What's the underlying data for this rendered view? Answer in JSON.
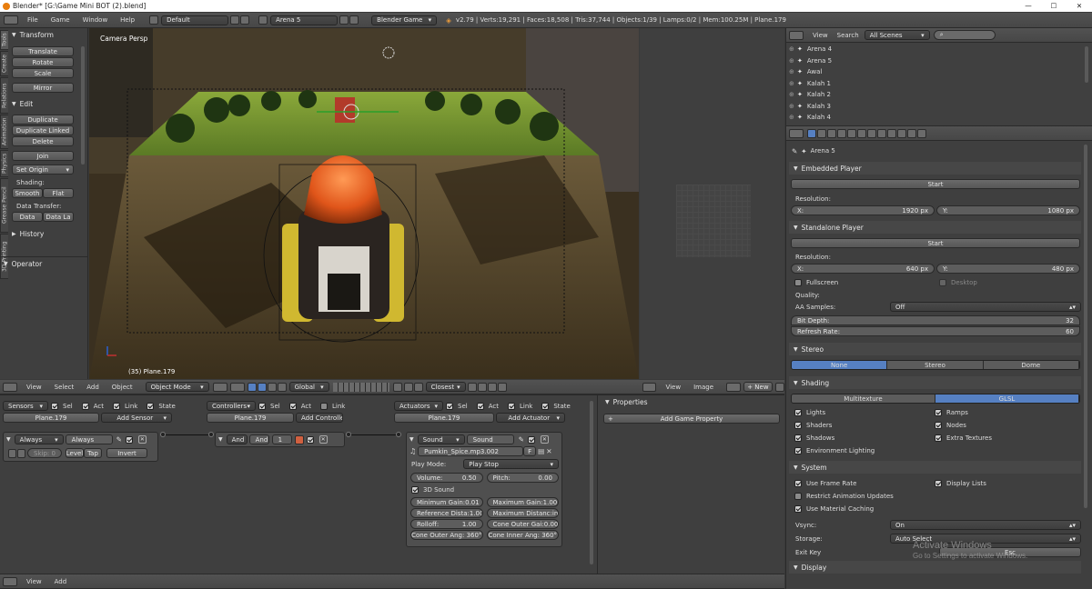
{
  "window": {
    "title": "Blender* [G:\\Game Mini BOT (2).blend]",
    "controls": {
      "min": "—",
      "max": "☐",
      "close": "✕"
    }
  },
  "topbar": {
    "menus": [
      "File",
      "Game",
      "Window",
      "Help"
    ],
    "layout": "Default",
    "scene": "Arena 5",
    "engine": "Blender Game",
    "stats": "v2.79 | Verts:19,291 | Faces:18,508 | Tris:37,744 | Objects:1/39 | Lamps:0/2 | Mem:100.25M | Plane.179"
  },
  "tool_shelf": {
    "tabs": [
      "Tools",
      "Create",
      "Relations",
      "Animation",
      "Physics",
      "Grease Pencil"
    ],
    "transform": {
      "title": "Transform",
      "buttons": [
        "Translate",
        "Rotate",
        "Scale",
        "Mirror"
      ]
    },
    "edit": {
      "title": "Edit",
      "buttons": [
        "Duplicate",
        "Duplicate Linked",
        "Delete",
        "Join"
      ],
      "set_origin": "Set Origin",
      "shading_label": "Shading:",
      "smooth": "Smooth",
      "flat": "Flat",
      "data_transfer_label": "Data Transfer:",
      "data": "Data",
      "data_la": "Data La"
    },
    "history": "History",
    "operator": "Operator",
    "tab_3d": "3D Printing"
  },
  "viewport": {
    "label": "Camera Persp",
    "object_label": "(35) Plane.179",
    "header": {
      "menus": [
        "View",
        "Select",
        "Add",
        "Object"
      ],
      "mode": "Object Mode",
      "orientation": "Global",
      "snap": "Closest"
    }
  },
  "image_editor": {
    "menus": [
      "View",
      "Image"
    ],
    "new": "New"
  },
  "outliner": {
    "view": "View",
    "search": "Search",
    "filter": "All Scenes",
    "items": [
      "Arena 4",
      "Arena 5",
      "Awal",
      "Kalah 1",
      "Kalah 2",
      "Kalah 3",
      "Kalah 4"
    ]
  },
  "properties": {
    "scene_name": "Arena 5",
    "embedded": {
      "title": "Embedded Player",
      "start": "Start",
      "resolution": "Resolution:",
      "x_label": "X:",
      "x": "1920 px",
      "y_label": "Y:",
      "y": "1080 px"
    },
    "standalone": {
      "title": "Standalone Player",
      "start": "Start",
      "resolution": "Resolution:",
      "x_label": "X:",
      "x": "640 px",
      "y_label": "Y:",
      "y": "480 px",
      "fullscreen": "Fullscreen",
      "desktop": "Desktop",
      "quality": "Quality:",
      "aa_label": "AA Samples:",
      "aa": "Off",
      "bit_label": "Bit Depth:",
      "bit": "32",
      "refresh_label": "Refresh Rate:",
      "refresh": "60"
    },
    "stereo": {
      "title": "Stereo",
      "options": [
        "None",
        "Stereo",
        "Dome"
      ]
    },
    "shading": {
      "title": "Shading",
      "options": [
        "Multitexture",
        "GLSL"
      ],
      "left": [
        "Lights",
        "Shaders",
        "Shadows",
        "Environment Lighting"
      ],
      "right": [
        "Ramps",
        "Nodes",
        "Extra Textures"
      ]
    },
    "system": {
      "title": "System",
      "use_frame_rate": "Use Frame Rate",
      "display_lists": "Display Lists",
      "restrict": "Restrict Animation Updates",
      "material_caching": "Use Material Caching",
      "vsync_label": "Vsync:",
      "vsync": "On",
      "storage_label": "Storage:",
      "storage": "Auto Select",
      "exit_label": "Exit Key",
      "exit": "Esc"
    },
    "display": {
      "title": "Display"
    }
  },
  "logic": {
    "sensors": {
      "label": "Sensors",
      "sel": "Sel",
      "act": "Act",
      "link": "Link",
      "state": "State",
      "object": "Plane.179",
      "add": "Add Sensor",
      "type": "Always",
      "name": "Always",
      "skip": "Skip:",
      "skip_val": "0",
      "level": "Level",
      "tap": "Tap",
      "invert": "Invert"
    },
    "controllers": {
      "label": "Controllers",
      "sel": "Sel",
      "act": "Act",
      "link": "Link",
      "object": "Plane.179",
      "add": "Add Controller",
      "type": "And",
      "name": "And",
      "num": "1"
    },
    "actuators": {
      "label": "Actuators",
      "sel": "Sel",
      "act": "Act",
      "link": "Link",
      "state": "State",
      "object": "Plane.179",
      "add": "Add Actuator",
      "type": "Sound",
      "name": "Sound",
      "file": "Pumkin_Spice.mp3.002",
      "f": "F",
      "play_mode_label": "Play Mode:",
      "play_mode": "Play Stop",
      "volume_label": "Volume:",
      "volume": "0.50",
      "pitch_label": "Pitch:",
      "pitch": "0.00",
      "sound3d": "3D Sound",
      "min_gain_label": "Minimum Gain:",
      "min_gain": "0.01",
      "max_gain_label": "Maximum Gain:",
      "max_gain": "1.00",
      "ref_label": "Reference Dista:",
      "ref": "1.00",
      "max_dist_label": "Maximum Distanc:",
      "max_dist": "inf",
      "rolloff_label": "Rolloff:",
      "rolloff": "1.00",
      "cone_gain_label": "Cone Outer Gai:",
      "cone_gain": "0.00",
      "cone_outer": "Cone Outer Ang: 360°",
      "cone_inner": "Cone Inner Ang: 360°"
    },
    "properties_panel": {
      "title": "Properties",
      "add": "Add Game Property"
    }
  },
  "bottom": {
    "menus": [
      "View",
      "Add"
    ]
  },
  "watermark": {
    "line1": "Activate Windows",
    "line2": "Go to Settings to activate Windows."
  }
}
